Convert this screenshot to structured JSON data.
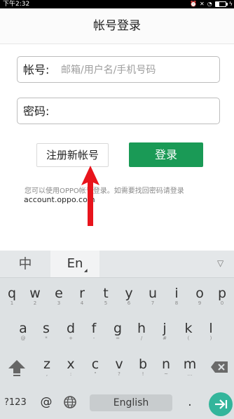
{
  "status_bar": {
    "time": "下午2:32",
    "icons": [
      "alarm-icon",
      "mute-icon",
      "wifi-icon",
      "battery-icon",
      "charging-icon"
    ]
  },
  "header": {
    "title": "帐号登录"
  },
  "form": {
    "account_label": "帐号:",
    "account_placeholder": "邮箱/用户名/手机号码",
    "password_label": "密码:",
    "register_label": "注册新帐号",
    "login_label": "登录",
    "hint_text": "您可以使用OPPO帐号登录。如需要找回密码请登录",
    "hint_link": "account.oppo.com"
  },
  "colors": {
    "accent": "#1a9a56",
    "enter_key": "#33b59b",
    "arrow": "#e8141c"
  },
  "keyboard": {
    "lang_zh": "中",
    "lang_en": "En",
    "row1": [
      {
        "ch": "q",
        "sub": "1"
      },
      {
        "ch": "w",
        "sub": "2"
      },
      {
        "ch": "e",
        "sub": "3"
      },
      {
        "ch": "r",
        "sub": "4"
      },
      {
        "ch": "t",
        "sub": "5"
      },
      {
        "ch": "y",
        "sub": "6"
      },
      {
        "ch": "u",
        "sub": "7"
      },
      {
        "ch": "i",
        "sub": "8"
      },
      {
        "ch": "o",
        "sub": "9"
      },
      {
        "ch": "p",
        "sub": "0"
      }
    ],
    "row2": [
      {
        "ch": "a",
        "sub": "@"
      },
      {
        "ch": "s",
        "sub": "*"
      },
      {
        "ch": "d",
        "sub": "+"
      },
      {
        "ch": "f",
        "sub": "-"
      },
      {
        "ch": "g",
        "sub": "="
      },
      {
        "ch": "h",
        "sub": "/"
      },
      {
        "ch": "j",
        "sub": "#"
      },
      {
        "ch": "k",
        "sub": "("
      },
      {
        "ch": "l",
        "sub": ")"
      }
    ],
    "row3": [
      {
        "ch": "z",
        "sub": ","
      },
      {
        "ch": "x",
        "sub": ":"
      },
      {
        "ch": "c",
        "sub": "\""
      },
      {
        "ch": "v",
        "sub": "?"
      },
      {
        "ch": "b",
        "sub": "!"
      },
      {
        "ch": "n",
        "sub": "~"
      },
      {
        "ch": "m",
        "sub": "…"
      }
    ],
    "numbers_key": "?123",
    "at_key": "@",
    "space_label": "English",
    "period_key": "."
  }
}
